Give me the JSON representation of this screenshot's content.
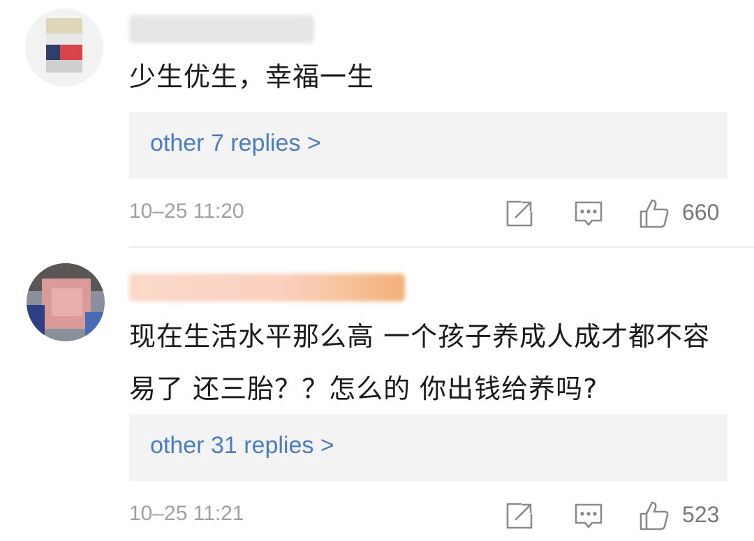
{
  "comments": [
    {
      "text": "少生优生，幸福一生",
      "replies_link": "other 7 replies >",
      "timestamp": "10–25 11:20",
      "likes": "660"
    },
    {
      "text": "现在生活水平那么高 一个孩子养成人成才都不容易了 还三胎？？怎么的 你出钱给养吗?",
      "replies_link": "other 31 replies >",
      "timestamp": "10–25 11:21",
      "likes": "523"
    }
  ],
  "colors": {
    "link": "#4a7cbf",
    "meta_text": "#a0a0a0",
    "reply_box_bg": "#f3f3f3",
    "divider": "#ececec",
    "icon_stroke": "#8a8a8a"
  },
  "icons": [
    "repost-icon",
    "comment-icon",
    "like-icon"
  ]
}
